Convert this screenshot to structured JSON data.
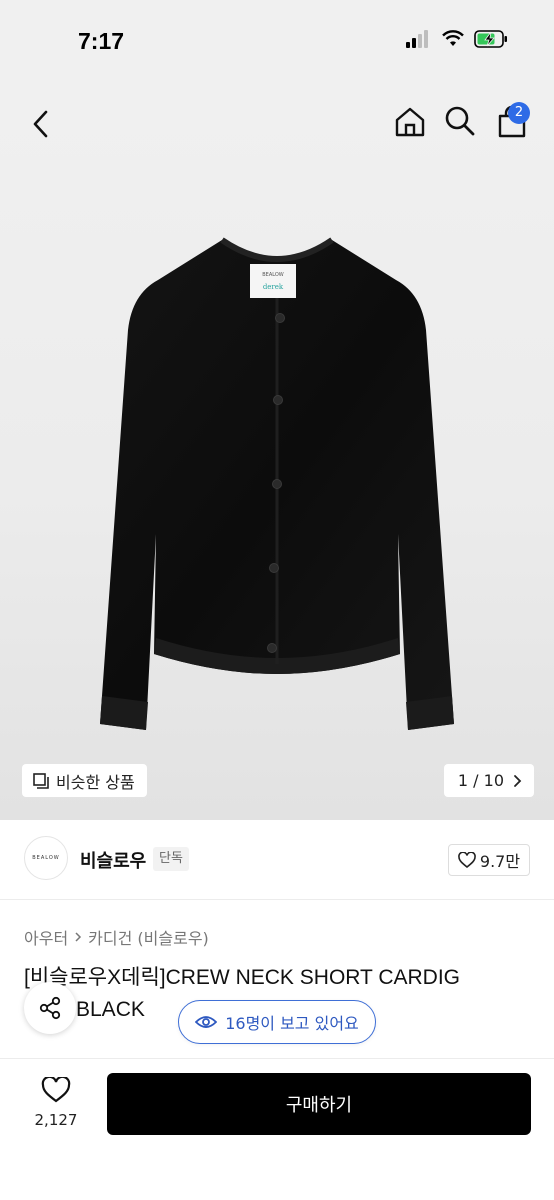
{
  "status_bar": {
    "time": "7:17",
    "icons": [
      "signal-icon",
      "wifi-icon",
      "battery-charging-icon"
    ],
    "battery_color": "#34c759"
  },
  "nav": {
    "icons": [
      "back-icon",
      "home-icon",
      "search-icon",
      "cart-icon"
    ],
    "cart_badge": "2",
    "badge_color": "#2e6be6"
  },
  "product_image": {
    "label_brand": "BEALOW",
    "label_collab": "derek",
    "similar_label": "비슷한 상품",
    "pager": "1 / 10"
  },
  "brand": {
    "logo_text": "BEALOW",
    "name": "비슬로우",
    "tag": "단독",
    "likes": "9.7만"
  },
  "breadcrumb": [
    "아우터",
    "카디건 (비슬로우)"
  ],
  "product": {
    "title_line1": "[비슬로우X데릭]CREW NECK SHORT CARDIG",
    "title_line2": "BLACK"
  },
  "viewers": "16명이 보고 있어요",
  "bottom_bar": {
    "wish_count": "2,127",
    "buy_label": "구매하기"
  }
}
